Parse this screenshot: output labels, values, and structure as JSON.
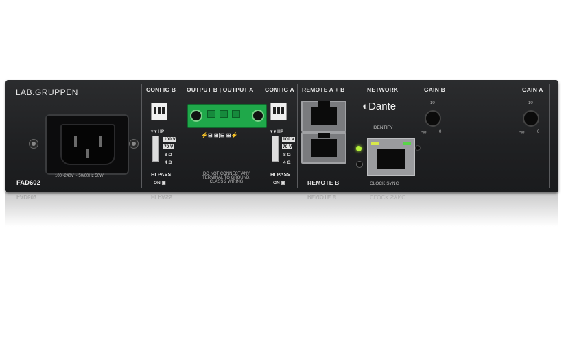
{
  "device": {
    "brand": "LAB.GRUPPEN",
    "model": "FAD602",
    "power_rating": "100~240V ~ 50/60Hz 50W"
  },
  "sections": {
    "config_b": "CONFIG B",
    "output": "OUTPUT B | OUTPUT A",
    "config_a": "CONFIG A",
    "remote_ab": "REMOTE A + B",
    "network": "NETWORK",
    "gain_b": "GAIN B",
    "gain_a": "GAIN A"
  },
  "config": {
    "hp": "HP",
    "v100": "100 V",
    "v70": "70 V",
    "ohm8": "8 Ω",
    "ohm4": "4 Ω",
    "hi_pass": "HI PASS",
    "on": "ON"
  },
  "output_warning": [
    "DO NOT CONNECT ANY",
    "TERMINAL TO GROUND.",
    "CLASS 2 WIRING"
  ],
  "output_polarity": "⚡⊟ ⊞|⊟ ⊞⚡",
  "remote_b": "REMOTE B",
  "network": {
    "dante": "Dante",
    "identify": "IDENTIFY",
    "clock_sync": "CLOCK SYNC",
    "identify_led_color": "#b7f23a"
  },
  "gain": {
    "max": "-10",
    "min": "-∞",
    "zero": "0"
  },
  "reflection_texts": [
    "FAD602",
    "HI PASS",
    "REMOTE B",
    "CLOCK SYNC"
  ]
}
